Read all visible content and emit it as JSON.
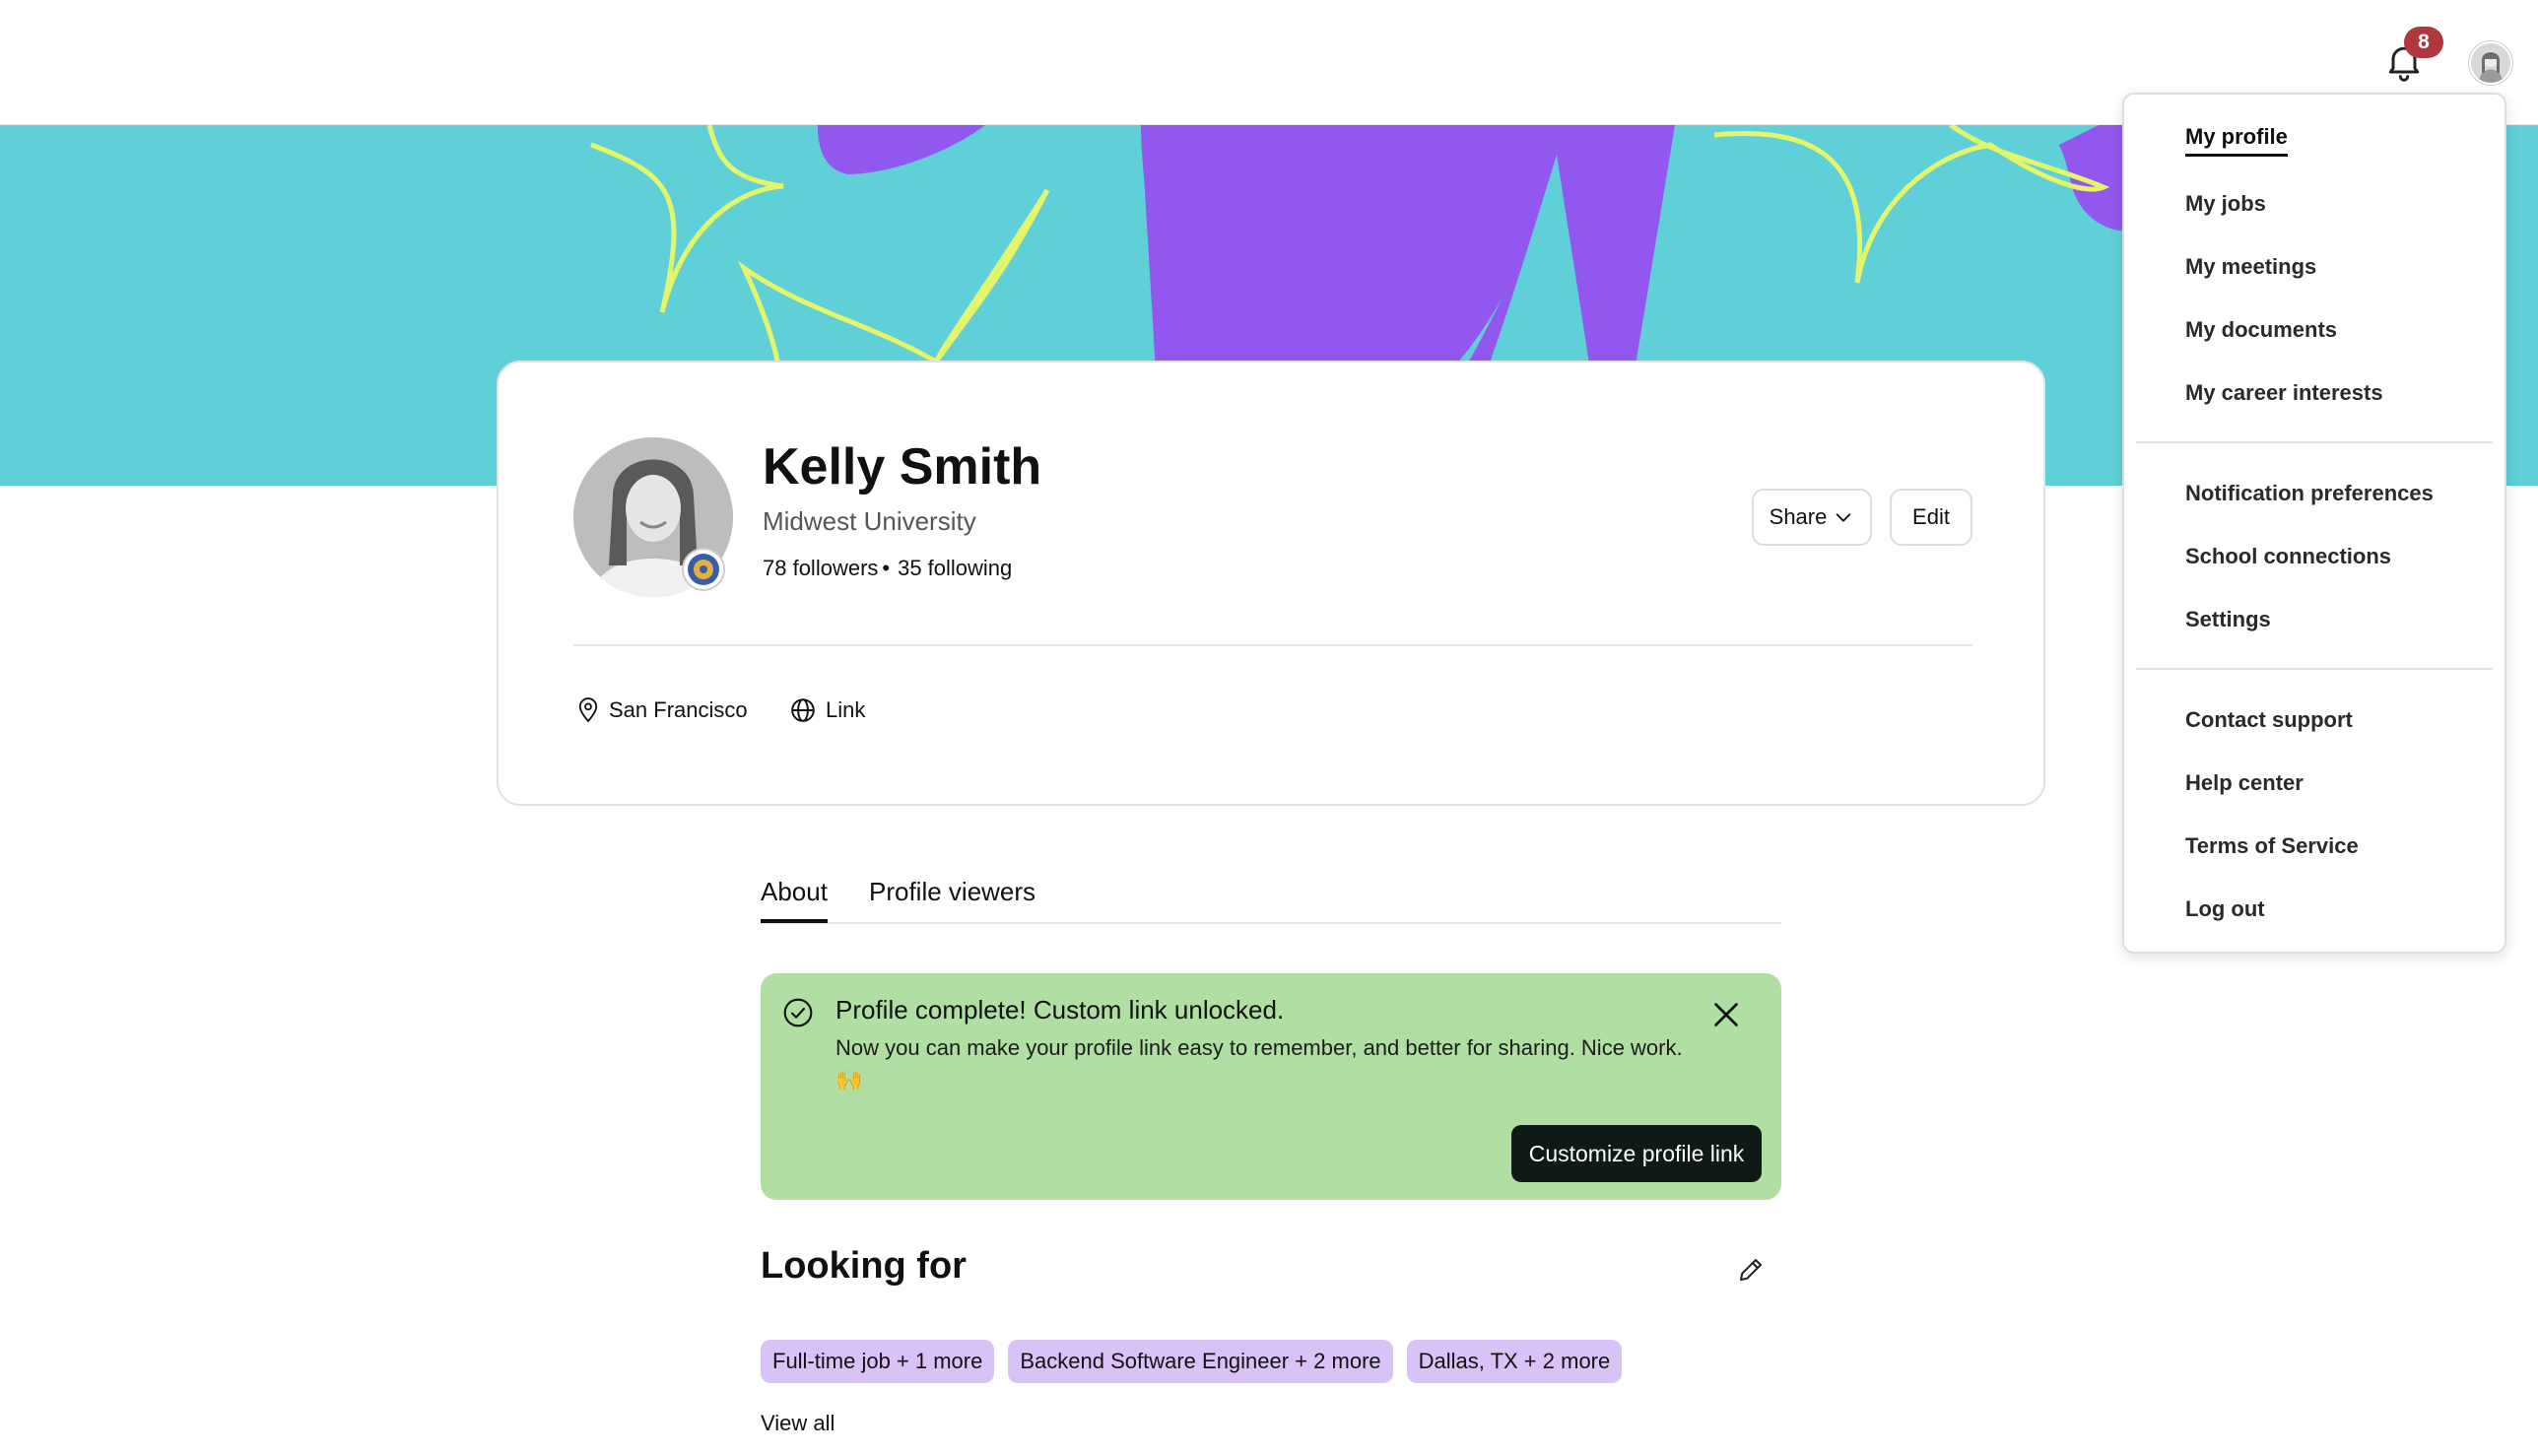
{
  "header": {
    "notification_count": "8",
    "icons": {
      "bell": "bell-icon",
      "avatar": "user-avatar"
    }
  },
  "profile": {
    "name": "Kelly Smith",
    "school": "Midwest University",
    "followers": "78 followers",
    "separator": "•",
    "following": "35 following",
    "share_label": "Share",
    "edit_label": "Edit",
    "location": "San Francisco",
    "link_label": "Link"
  },
  "tabs": [
    {
      "label": "About",
      "active": true
    },
    {
      "label": "Profile viewers",
      "active": false
    }
  ],
  "alert": {
    "title": "Profile complete! Custom link unlocked.",
    "body": "Now you can make your profile link easy to remember, and better for sharing. Nice work. 🙌",
    "button_label": "Customize profile link"
  },
  "looking_for": {
    "title": "Looking for",
    "chips": [
      "Full-time job + 1 more",
      "Backend Software Engineer + 2 more",
      "Dallas, TX + 2 more"
    ],
    "view_all_label": "View all"
  },
  "menu": {
    "group1": [
      "My profile",
      "My jobs",
      "My meetings",
      "My documents",
      "My career interests"
    ],
    "group2": [
      "Notification preferences",
      "School connections",
      "Settings"
    ],
    "group3": [
      "Contact support",
      "Help center",
      "Terms of Service",
      "Log out"
    ],
    "active": "My profile"
  },
  "colors": {
    "banner_teal": "#5fd0d7",
    "banner_purple": "#9257ee",
    "banner_lime": "#e4f56a",
    "alert_green": "#b1dea3",
    "chip_purple": "#d9c2f5",
    "badge_red": "#b0383d"
  }
}
